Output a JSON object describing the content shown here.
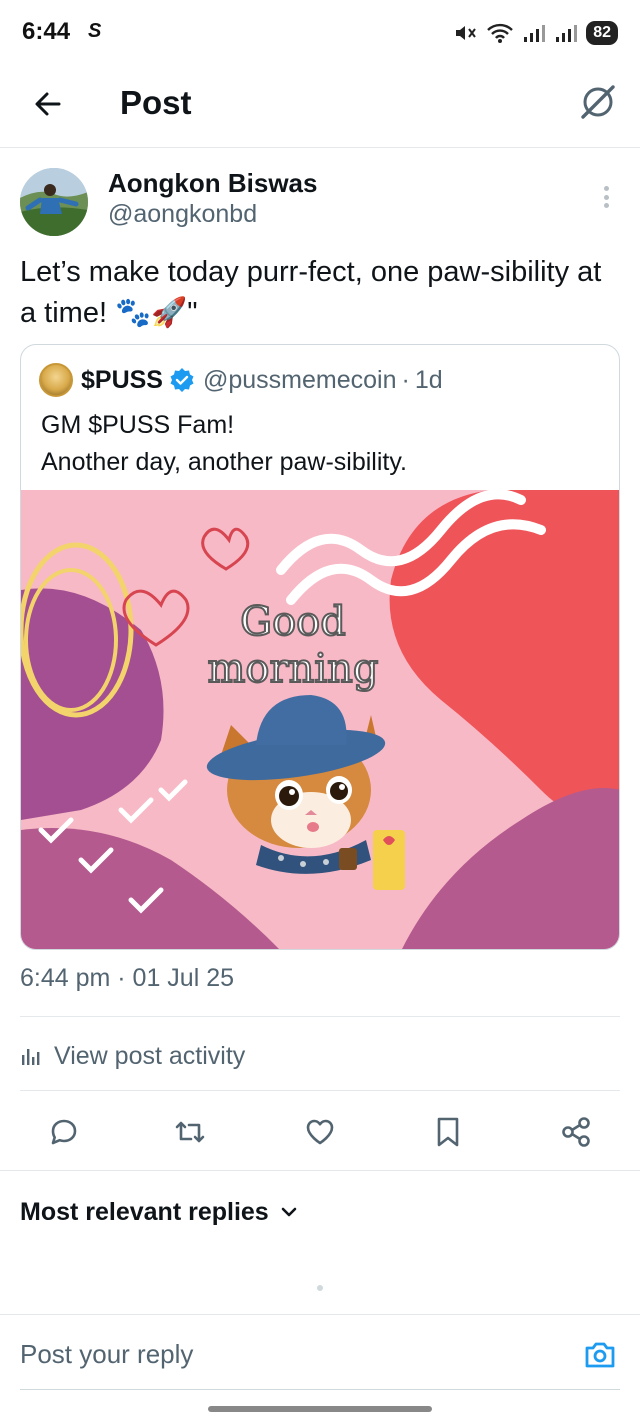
{
  "status_bar": {
    "time": "6:44",
    "carrier_glyph": "S",
    "battery": "82",
    "icons": [
      "mute-icon",
      "wifi-icon",
      "signal-icon",
      "signal-icon",
      "battery-icon"
    ]
  },
  "header": {
    "title": "Post",
    "back_icon": "arrow-left-icon",
    "grok_icon": "grok-icon"
  },
  "post": {
    "author_name": "Aongkon Biswas",
    "author_handle": "@aongkonbd",
    "text": "Let’s make today purr-fect, one paw-sibility at a time! 🐾🚀\"",
    "timestamp": "6:44 pm · 01 Jul 25"
  },
  "quote": {
    "name": "$PUSS",
    "handle": "@pussmemecoin",
    "separator": "·",
    "time": "1d",
    "line1": "GM $PUSS Fam!",
    "line2": "Another day, another paw-sibility.",
    "image": {
      "greeting_line1": "Good",
      "greeting_line2": "morning",
      "colors": {
        "background": "#f8b9c6",
        "red_blob": "#ef5459",
        "purple_blob": "#a34f91",
        "magenta_blob": "#b45a8e",
        "yellow_scribble": "#f3d36b"
      }
    }
  },
  "activity": {
    "label": "View post activity"
  },
  "actions": [
    "reply-icon",
    "repost-icon",
    "like-icon",
    "bookmark-icon",
    "share-icon"
  ],
  "replies": {
    "sort_label": "Most relevant replies"
  },
  "reply_bar": {
    "placeholder": "Post your reply"
  },
  "colors": {
    "accent": "#1d9bf0",
    "text_primary": "#0f1419",
    "text_secondary": "#536471",
    "divider": "#e6e9ec"
  }
}
